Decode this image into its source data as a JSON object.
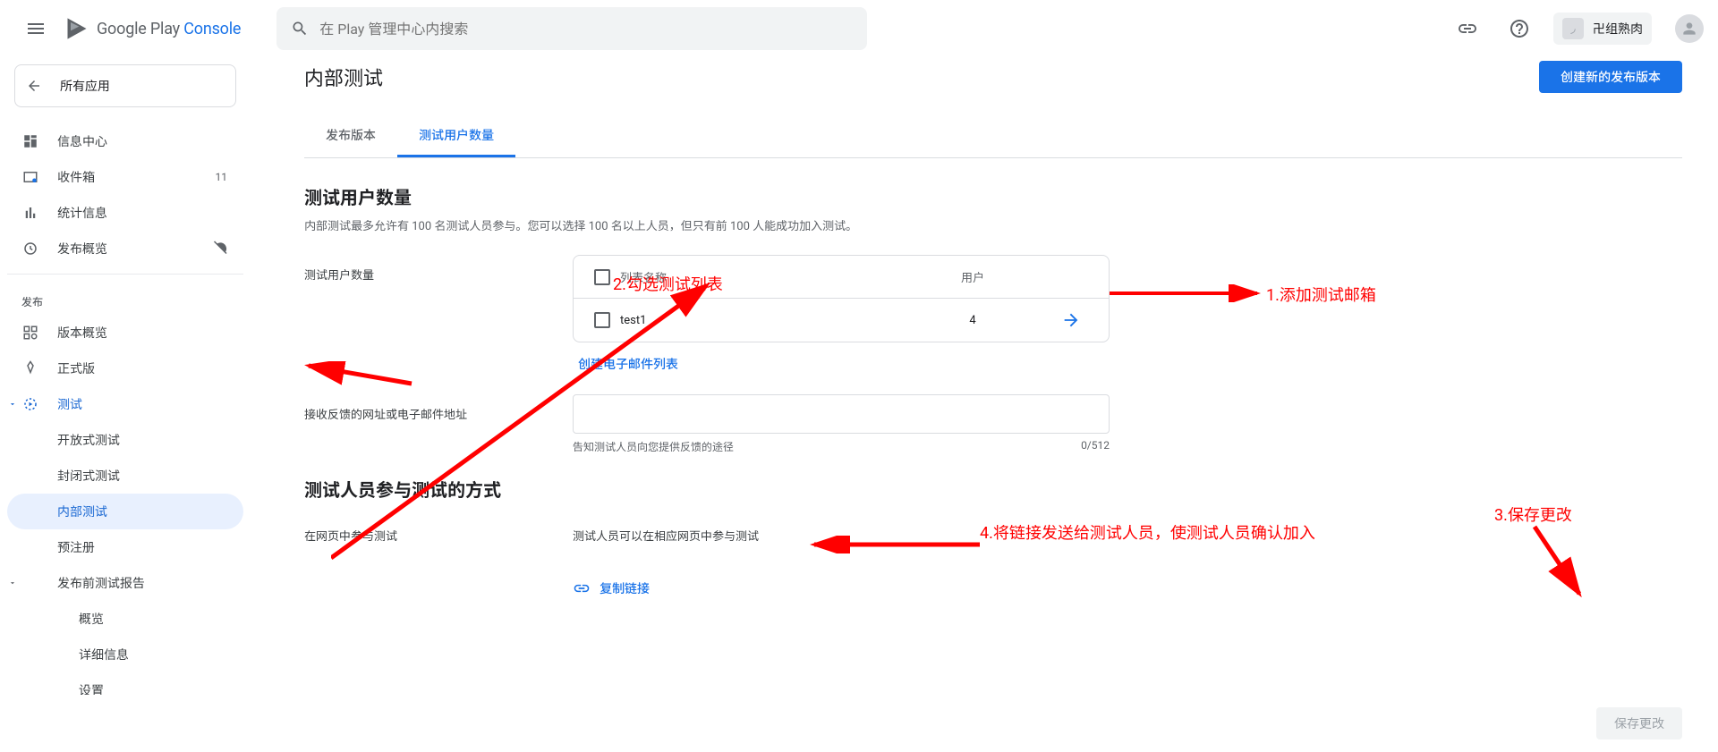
{
  "header": {
    "logo_prefix": "Google Play ",
    "logo_suffix": "Console",
    "search_placeholder": "在 Play 管理中心内搜索",
    "user_app_name": "卍组熟肉"
  },
  "sidebar": {
    "back_label": "所有应用",
    "items": {
      "dashboard": "信息中心",
      "inbox": "收件箱",
      "inbox_badge": "11",
      "stats": "统计信息",
      "pub_overview": "发布概览"
    },
    "publish_section": "发布",
    "publish": {
      "release_overview": "版本概览",
      "production": "正式版",
      "testing": "测试",
      "open_testing": "开放式测试",
      "closed_testing": "封闭式测试",
      "internal_testing": "内部测试",
      "pre_reg": "预注册",
      "prelaunch": "发布前测试报告",
      "pl_overview": "概览",
      "pl_details": "详细信息",
      "pl_settings": "设置"
    }
  },
  "main": {
    "page_title": "内部测试",
    "create_release_btn": "创建新的发布版本",
    "tabs": {
      "releases": "发布版本",
      "testers": "测试用户数量"
    },
    "section_title": "测试用户数量",
    "section_desc": "内部测试最多允许有 100 名测试人员参与。您可以选择 100 名以上人员，但只有前 100 人能成功加入测试。",
    "form": {
      "testers_label": "测试用户数量",
      "table": {
        "col_name": "列表名称",
        "col_users": "用户",
        "rows": [
          {
            "name": "test1",
            "users": "4"
          }
        ]
      },
      "create_list": "创建电子邮件列表",
      "feedback_label": "接收反馈的网址或电子邮件地址",
      "feedback_helper": "告知测试人员向您提供反馈的途径",
      "feedback_counter": "0/512",
      "method_title": "测试人员参与测试的方式",
      "web_join_label": "在网页中参与测试",
      "web_join_desc": "测试人员可以在相应网页中参与测试",
      "copy_link": "复制链接"
    },
    "save_btn": "保存更改"
  },
  "annotations": {
    "a1": "1.添加测试邮箱",
    "a2": "2.勾选测试列表",
    "a3": "3.保存更改",
    "a4": "4.将链接发送给测试人员，使测试人员确认加入"
  }
}
